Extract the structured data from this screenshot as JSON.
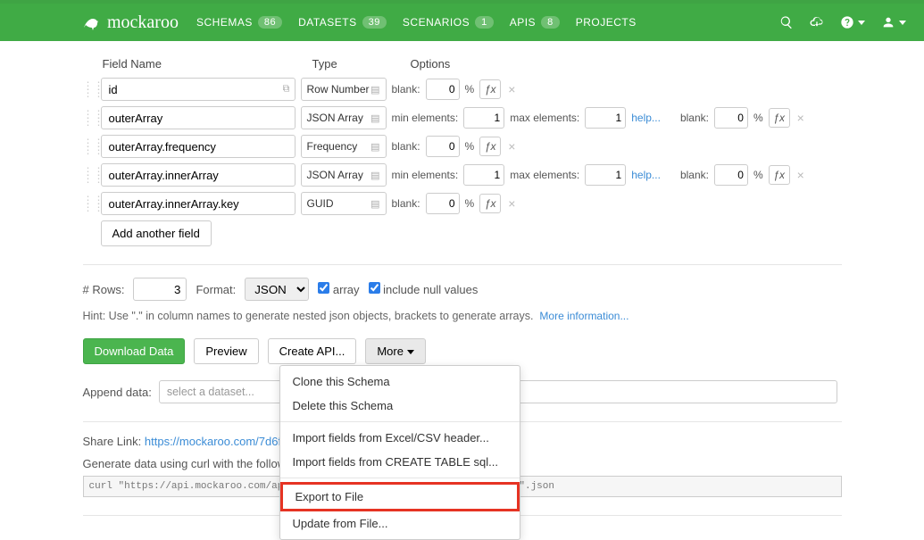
{
  "brand": "mockaroo",
  "nav": {
    "schemas": {
      "label": "SCHEMAS",
      "count": "86"
    },
    "datasets": {
      "label": "DATASETS",
      "count": "39"
    },
    "scenarios": {
      "label": "SCENARIOS",
      "count": "1"
    },
    "apis": {
      "label": "APIS",
      "count": "8"
    },
    "projects": {
      "label": "PROJECTS"
    }
  },
  "headers": {
    "field_name": "Field Name",
    "type": "Type",
    "options": "Options"
  },
  "fields": [
    {
      "name": "id",
      "type": "Row Number",
      "show_hash": true,
      "opt_kind": "blank"
    },
    {
      "name": "outerArray",
      "type": "JSON Array",
      "opt_kind": "array"
    },
    {
      "name": "outerArray.frequency",
      "type": "Frequency",
      "opt_kind": "blank"
    },
    {
      "name": "outerArray.innerArray",
      "type": "JSON Array",
      "opt_kind": "array"
    },
    {
      "name": "outerArray.innerArray.key",
      "type": "GUID",
      "opt_kind": "blank"
    }
  ],
  "blank_opts": {
    "label": "blank:",
    "value": "0",
    "pct": "%",
    "fx": "ƒx"
  },
  "array_opts": {
    "min_label": "min elements:",
    "min_value": "1",
    "max_label": "max elements:",
    "max_value": "1",
    "help": "help...",
    "blank_label": "blank:",
    "blank_value": "0",
    "pct": "%",
    "fx": "ƒx"
  },
  "add_field": "Add another field",
  "rows": {
    "label": "# Rows:",
    "value": "3"
  },
  "format": {
    "label": "Format:",
    "value": "JSON"
  },
  "array_cb": "array",
  "null_cb": "include null values",
  "hint": {
    "text": "Hint: Use \".\" in column names to generate nested json objects, brackets to generate arrays.",
    "more": "More information..."
  },
  "buttons": {
    "download": "Download Data",
    "preview": "Preview",
    "api": "Create API...",
    "more": "More"
  },
  "dropdown": {
    "clone": "Clone this Schema",
    "delete": "Delete this Schema",
    "import_excel": "Import fields from Excel/CSV header...",
    "import_sql": "Import fields from CREATE TABLE sql...",
    "export": "Export to File",
    "update": "Update from File..."
  },
  "append": {
    "label": "Append data:",
    "placeholder": "select a dataset..."
  },
  "share": {
    "label": "Share Link:",
    "url": "https://mockaroo.com/7d6fba70"
  },
  "curl": {
    "label": "Generate data using curl with the following command:",
    "cmd": "curl \"https://api.mockaroo.com/api/7d6fba70?count=3&key=5cbc29b0\" > \"4452\".json"
  }
}
